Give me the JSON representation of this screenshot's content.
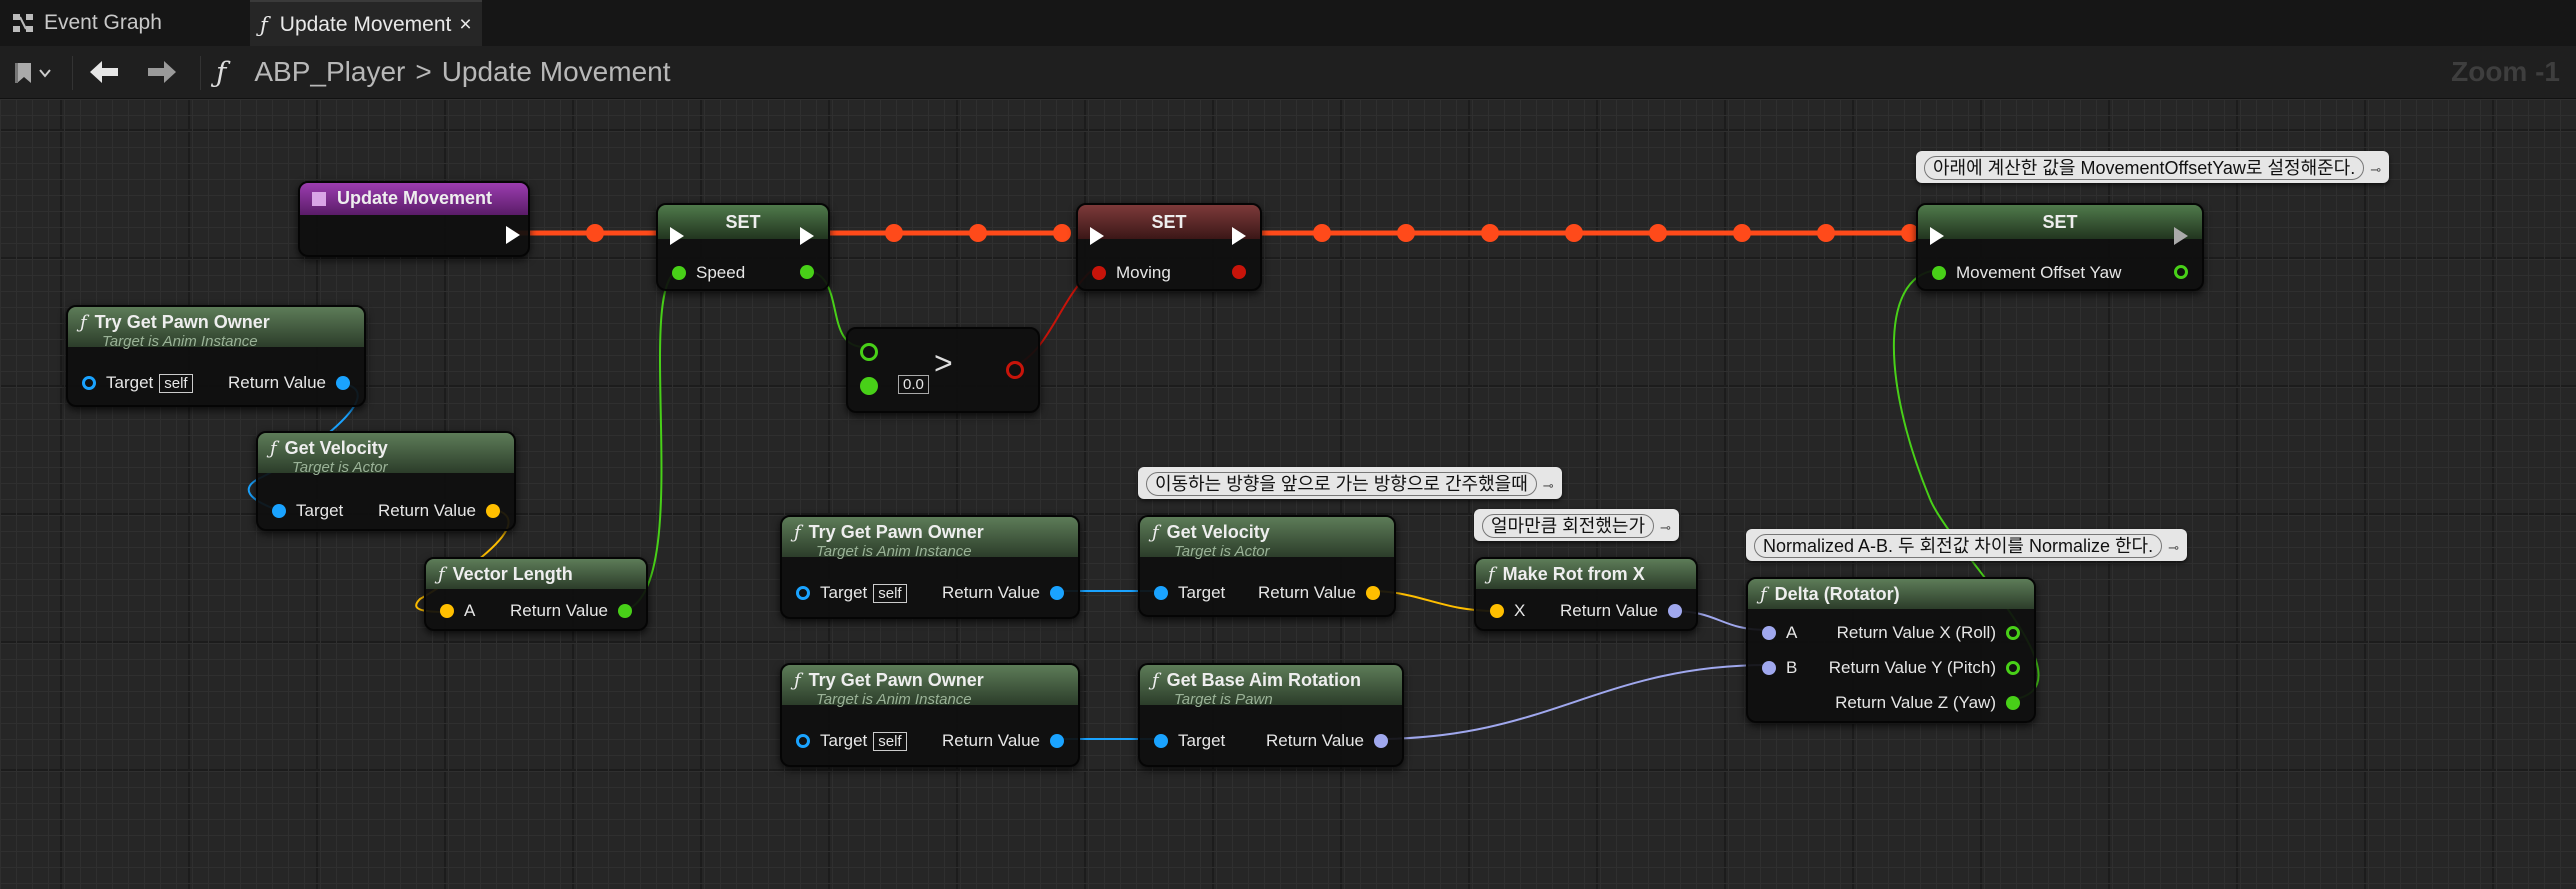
{
  "tabs": [
    {
      "label": "Event Graph",
      "icon": "event-graph-icon"
    },
    {
      "label": "Update Movement",
      "icon": "function-icon",
      "close": "×"
    }
  ],
  "toolbar": {
    "breadcrumb_root": "ABP_Player",
    "breadcrumb_sep": ">",
    "breadcrumb_leaf": "Update Movement",
    "zoom": "Zoom -1"
  },
  "nodes": {
    "event": {
      "title": "Update Movement"
    },
    "set1": {
      "title": "SET",
      "pin": "Speed"
    },
    "compare": {
      "op": ">",
      "b_value": "0.0"
    },
    "set2": {
      "title": "SET",
      "pin": "Moving"
    },
    "set3": {
      "title": "SET",
      "pin": "Movement Offset Yaw"
    },
    "tgpo1": {
      "title": "Try Get Pawn Owner",
      "sub": "Target is Anim Instance",
      "target": "Target",
      "self": "self",
      "ret": "Return Value"
    },
    "getvel1": {
      "title": "Get Velocity",
      "sub": "Target is Actor",
      "target": "Target",
      "ret": "Return Value"
    },
    "veclen": {
      "title": "Vector Length",
      "a": "A",
      "ret": "Return Value"
    },
    "tgpo2": {
      "title": "Try Get Pawn Owner",
      "sub": "Target is Anim Instance",
      "target": "Target",
      "self": "self",
      "ret": "Return Value"
    },
    "getvel2": {
      "title": "Get Velocity",
      "sub": "Target is Actor",
      "target": "Target",
      "ret": "Return Value"
    },
    "makerot": {
      "title": "Make Rot from X",
      "x": "X",
      "ret": "Return Value"
    },
    "tgpo3": {
      "title": "Try Get Pawn Owner",
      "sub": "Target is Anim Instance",
      "target": "Target",
      "self": "self",
      "ret": "Return Value"
    },
    "getaim": {
      "title": "Get Base Aim Rotation",
      "sub": "Target is Pawn",
      "target": "Target",
      "ret": "Return Value"
    },
    "delta": {
      "title": "Delta (Rotator)",
      "a": "A",
      "b": "B",
      "rx": "Return Value X (Roll)",
      "ry": "Return Value Y (Pitch)",
      "rz": "Return Value Z (Yaw)"
    }
  },
  "comments": {
    "c1": "아래에 계산한 값을 MovementOffsetYaw로 설정해준다.",
    "c2": "이동하는 방향을 앞으로 가는 방향으로 간주했을때",
    "c3": "얼마만큼 회전했는가",
    "c4": "Normalized A-B. 두 회전값 차이를 Normalize 한다."
  },
  "colors": {
    "exec_wire": "#ff4a1a",
    "object_pin": "#1aa3ff",
    "float_pin": "#48d018",
    "vector_pin": "#ffbf00",
    "rotator_pin": "#a0a8ee",
    "bool_pin": "#c8140a"
  }
}
